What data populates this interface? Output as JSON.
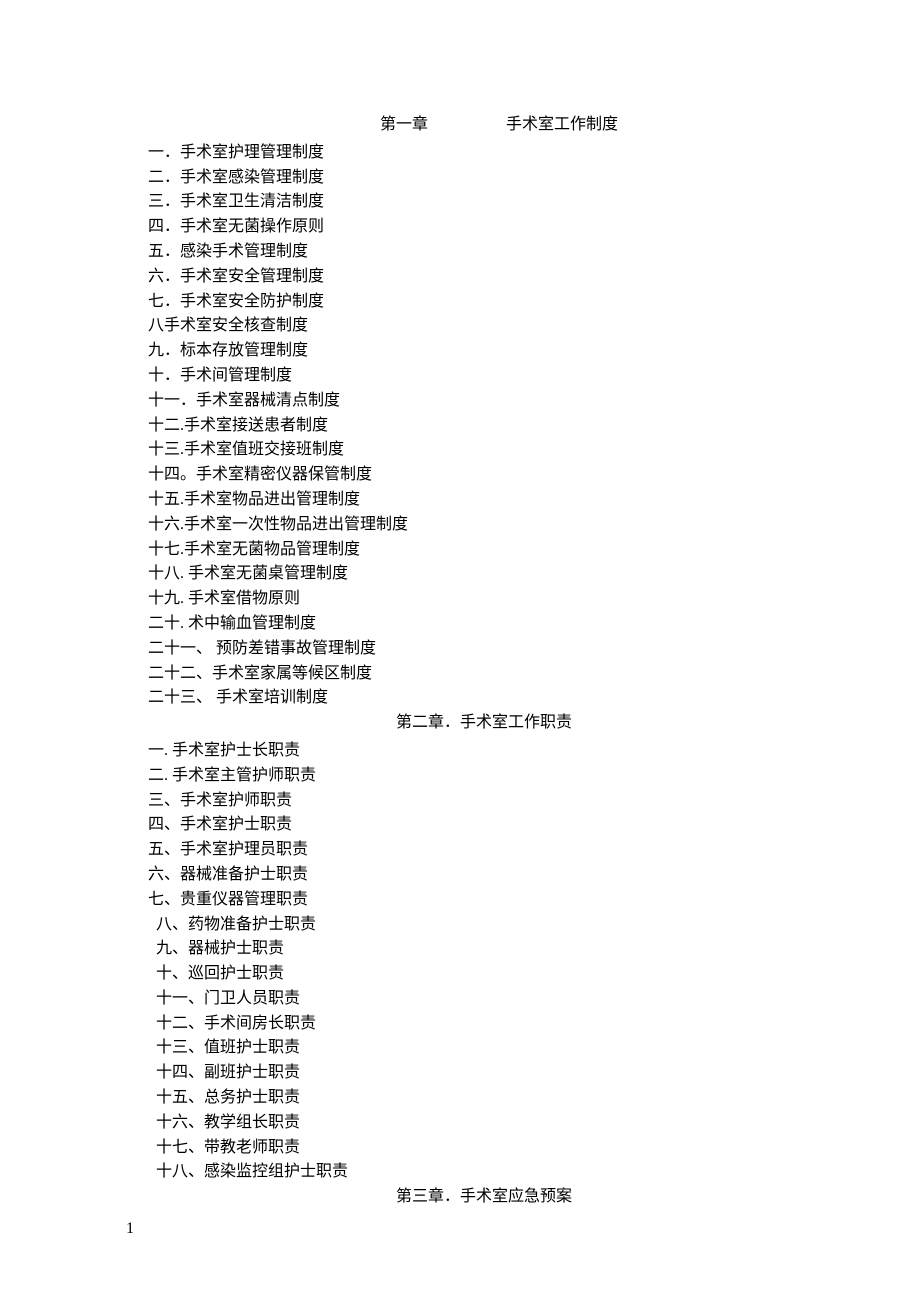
{
  "chapter1": {
    "label": "第一章",
    "title": "手术室工作制度",
    "items": [
      "一．手术室护理管理制度",
      "二．手术室感染管理制度",
      "三．手术室卫生清洁制度",
      "四．手术室无菌操作原则",
      "五．感染手术管理制度",
      "六．手术室安全管理制度",
      "七．手术室安全防护制度",
      "八手术室安全核查制度",
      "九．标本存放管理制度",
      "十．手术间管理制度",
      "十一．手术室器械清点制度",
      "十二.手术室接送患者制度",
      "十三.手术室值班交接班制度",
      "十四。手术室精密仪器保管制度",
      "十五.手术室物品进出管理制度",
      "十六.手术室一次性物品进出管理制度",
      "十七.手术室无菌物品管理制度",
      "十八. 手术室无菌桌管理制度",
      "十九. 手术室借物原则",
      "二十. 术中输血管理制度",
      "二十一、 预防差错事故管理制度",
      "二十二、手术室家属等候区制度",
      "二十三、 手术室培训制度"
    ]
  },
  "chapter2": {
    "title": "第二章．手术室工作职责",
    "items": [
      {
        "text": "一. 手术室护士长职责",
        "indent": false
      },
      {
        "text": "二. 手术室主管护师职责",
        "indent": false
      },
      {
        "text": "三、手术室护师职责",
        "indent": false
      },
      {
        "text": "四、手术室护士职责",
        "indent": false
      },
      {
        "text": "五、手术室护理员职责",
        "indent": false
      },
      {
        "text": "六、器械准备护士职责",
        "indent": false
      },
      {
        "text": "七、贵重仪器管理职责",
        "indent": false
      },
      {
        "text": "八、药物准备护士职责",
        "indent": true
      },
      {
        "text": "九、器械护士职责",
        "indent": true
      },
      {
        "text": "十、巡回护士职责",
        "indent": true
      },
      {
        "text": "十一、门卫人员职责",
        "indent": true
      },
      {
        "text": "十二、手术间房长职责",
        "indent": true
      },
      {
        "text": "十三、值班护士职责",
        "indent": true
      },
      {
        "text": "十四、副班护士职责",
        "indent": true
      },
      {
        "text": "十五、总务护士职责",
        "indent": true
      },
      {
        "text": "十六、教学组长职责",
        "indent": true
      },
      {
        "text": "十七、带教老师职责",
        "indent": true
      },
      {
        "text": "十八、感染监控组护士职责",
        "indent": true
      }
    ]
  },
  "chapter3": {
    "title": "第三章．手术室应急预案"
  },
  "page_number": "1"
}
